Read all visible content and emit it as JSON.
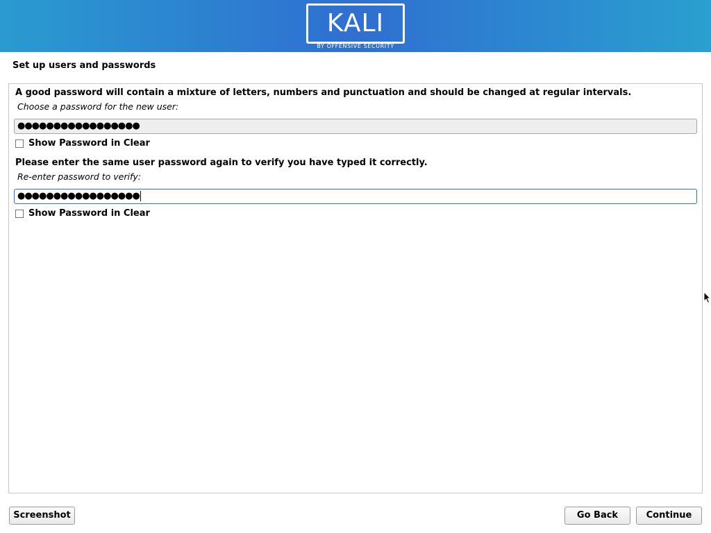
{
  "header": {
    "logo_text": "KALI",
    "logo_subtitle": "BY OFFENSIVE SECURITY",
    "colors": {
      "banner_start": "#2a9bd0",
      "banner_mid": "#2f6fd1",
      "banner_end": "#2aa0cf"
    }
  },
  "page": {
    "title": "Set up users and passwords"
  },
  "form": {
    "password_hint": "A good password will contain a mixture of letters, numbers and punctuation and should be changed at regular intervals.",
    "password_prompt": "Choose a password for the new user:",
    "password_value": "●●●●●●●●●●●●●●●●●",
    "show_password_label_1": "Show Password in Clear",
    "verify_hint": "Please enter the same user password again to verify you have typed it correctly.",
    "verify_prompt": "Re-enter password to verify:",
    "verify_value": "●●●●●●●●●●●●●●●●●",
    "show_password_label_2": "Show Password in Clear"
  },
  "footer": {
    "screenshot_label": "Screenshot",
    "back_label": "Go Back",
    "continue_label": "Continue"
  }
}
